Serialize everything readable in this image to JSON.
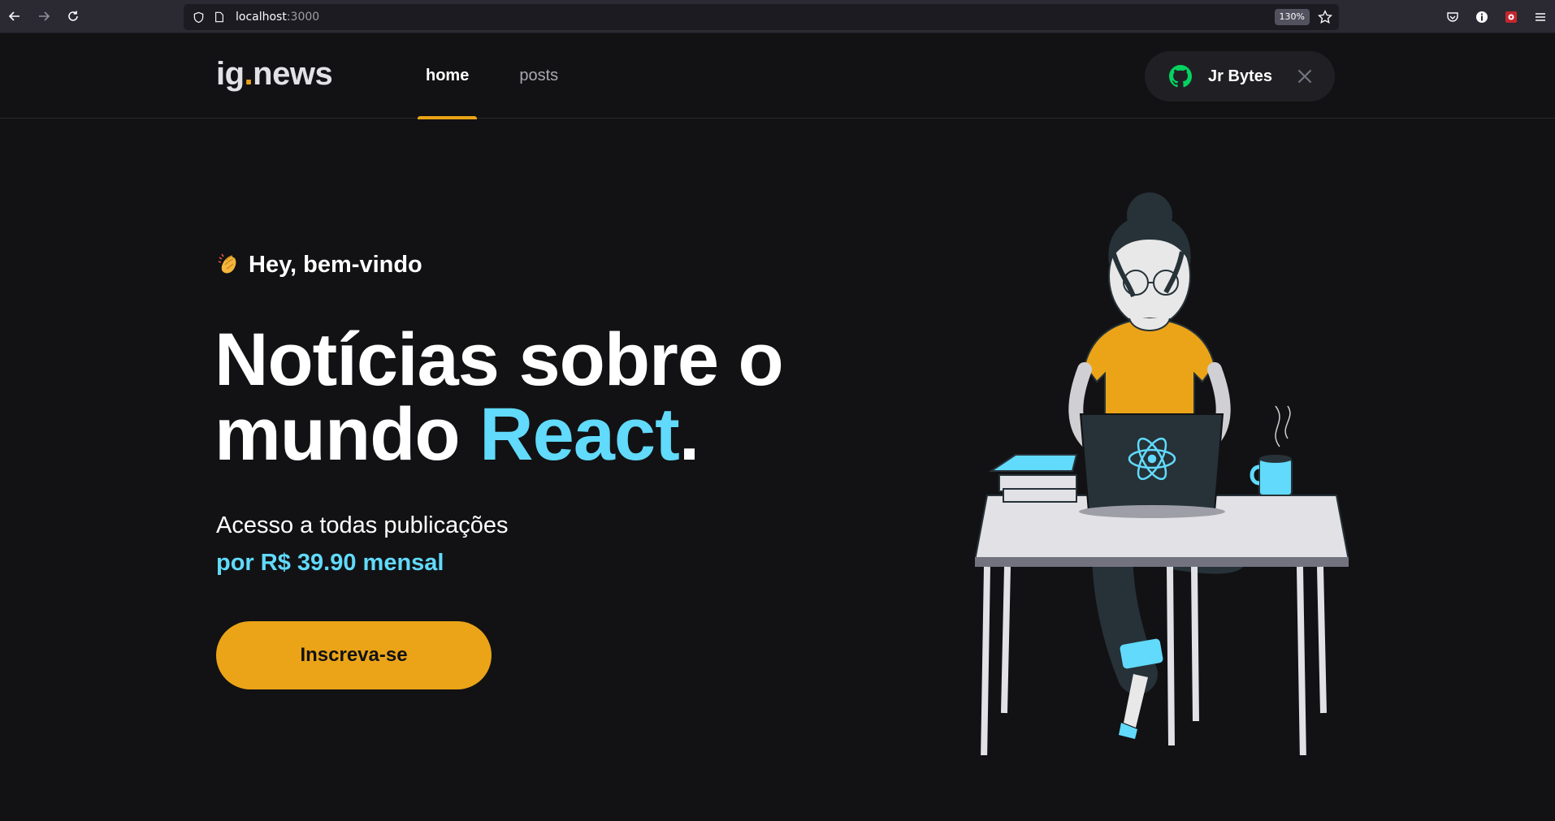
{
  "browser": {
    "url_host": "localhost",
    "url_port": ":3000",
    "zoom": "130%"
  },
  "header": {
    "logo_main": "ig",
    "logo_dot": ".",
    "logo_rest": "news",
    "nav": [
      {
        "label": "home",
        "active": true
      },
      {
        "label": "posts",
        "active": false
      }
    ],
    "user_name": "Jr Bytes"
  },
  "hero": {
    "greeting": "Hey, bem-vindo",
    "title_line1": "Notícias sobre o",
    "title_line2_start": "mundo ",
    "title_accent": "React",
    "title_end": ".",
    "subtitle": "Acesso a todas publicações",
    "price": "por R$ 39.90 mensal",
    "cta_label": "Inscreva-se"
  },
  "colors": {
    "background": "#121214",
    "accent_yellow": "#eba417",
    "accent_cyan": "#61dafb"
  },
  "icons": [
    "back-icon",
    "forward-icon",
    "reload-icon",
    "shield-icon",
    "page-icon",
    "bookmark-star-icon",
    "pocket-icon",
    "info-icon",
    "extension-icon",
    "menu-icon",
    "github-icon",
    "close-icon",
    "clap-emoji-icon"
  ]
}
